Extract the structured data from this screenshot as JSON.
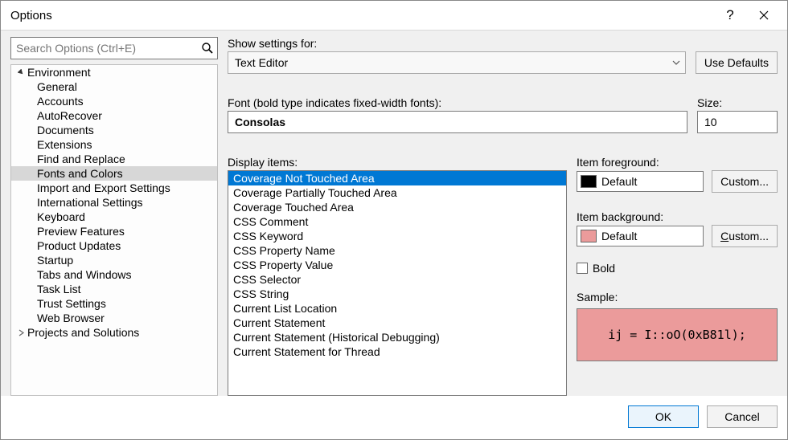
{
  "window": {
    "title": "Options"
  },
  "search": {
    "placeholder": "Search Options (Ctrl+E)"
  },
  "tree": {
    "root": "Environment",
    "items": [
      "General",
      "Accounts",
      "AutoRecover",
      "Documents",
      "Extensions",
      "Find and Replace",
      "Fonts and Colors",
      "Import and Export Settings",
      "International Settings",
      "Keyboard",
      "Preview Features",
      "Product Updates",
      "Startup",
      "Tabs and Windows",
      "Task List",
      "Trust Settings",
      "Web Browser"
    ],
    "second_root": "Projects and Solutions",
    "selected_index": 6
  },
  "show_settings": {
    "label": "Show settings for:",
    "value": "Text Editor"
  },
  "use_defaults": "Use Defaults",
  "font": {
    "label": "Font (bold type indicates fixed-width fonts):",
    "value": "Consolas"
  },
  "size": {
    "label": "Size:",
    "value": "10"
  },
  "display_items": {
    "label": "Display items:",
    "items": [
      "Coverage Not Touched Area",
      "Coverage Partially Touched Area",
      "Coverage Touched Area",
      "CSS Comment",
      "CSS Keyword",
      "CSS Property Name",
      "CSS Property Value",
      "CSS Selector",
      "CSS String",
      "Current List Location",
      "Current Statement",
      "Current Statement (Historical Debugging)",
      "Current Statement for Thread"
    ],
    "selected_index": 0
  },
  "foreground": {
    "label": "Item foreground:",
    "value": "Default",
    "swatch": "#000000"
  },
  "background": {
    "label": "Item background:",
    "value": "Default",
    "swatch": "#eb9b9b"
  },
  "custom_btn": "Custom...",
  "bold": {
    "label": "Bold",
    "checked": false
  },
  "sample": {
    "label": "Sample:",
    "text": "ij = I::oO(0xB81l);"
  },
  "footer": {
    "ok": "OK",
    "cancel": "Cancel"
  }
}
